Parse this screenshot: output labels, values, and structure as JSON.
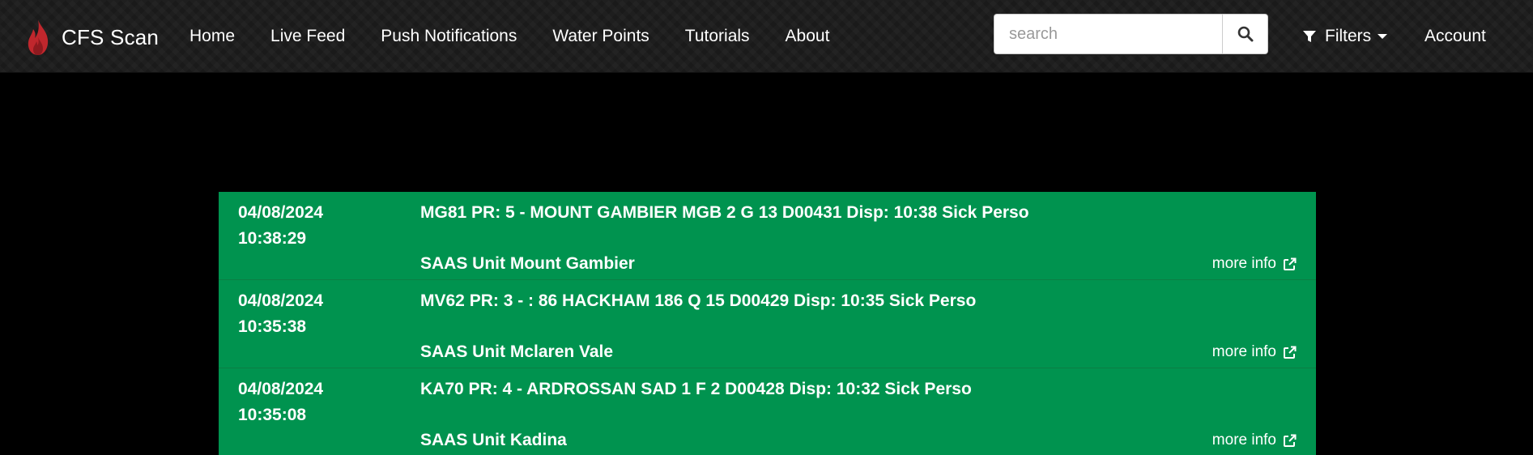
{
  "brand": {
    "name": "CFS Scan",
    "logo_icon": "flame-icon",
    "logo_color": "#c0272d"
  },
  "nav": {
    "items": [
      {
        "label": "Home"
      },
      {
        "label": "Live Feed"
      },
      {
        "label": "Push Notifications"
      },
      {
        "label": "Water Points"
      },
      {
        "label": "Tutorials"
      },
      {
        "label": "About"
      }
    ]
  },
  "search": {
    "placeholder": "search",
    "value": "",
    "button_icon": "search-icon"
  },
  "filters": {
    "label": "Filters",
    "icon": "filter-icon"
  },
  "account": {
    "label": "Account"
  },
  "colors": {
    "navbar_bg": "#1a1a1a",
    "feed_bg": "#00934f",
    "page_bg": "#000000"
  },
  "feed": {
    "items": [
      {
        "date": "04/08/2024",
        "time": "10:38:29",
        "title": "MG81 PR: 5 - MOUNT GAMBIER MGB 2 G 13 D00431 Disp: 10:38 Sick Perso",
        "unit": "SAAS Unit Mount Gambier",
        "more_info": "more info"
      },
      {
        "date": "04/08/2024",
        "time": "10:35:38",
        "title": "MV62 PR: 3 - : 86 HACKHAM 186 Q 15 D00429 Disp: 10:35 Sick Perso",
        "unit": "SAAS Unit Mclaren Vale",
        "more_info": "more info"
      },
      {
        "date": "04/08/2024",
        "time": "10:35:08",
        "title": "KA70 PR: 4 - ARDROSSAN SAD 1 F 2 D00428 Disp: 10:32 Sick Perso",
        "unit": "SAAS Unit Kadina",
        "more_info": "more info"
      }
    ]
  }
}
